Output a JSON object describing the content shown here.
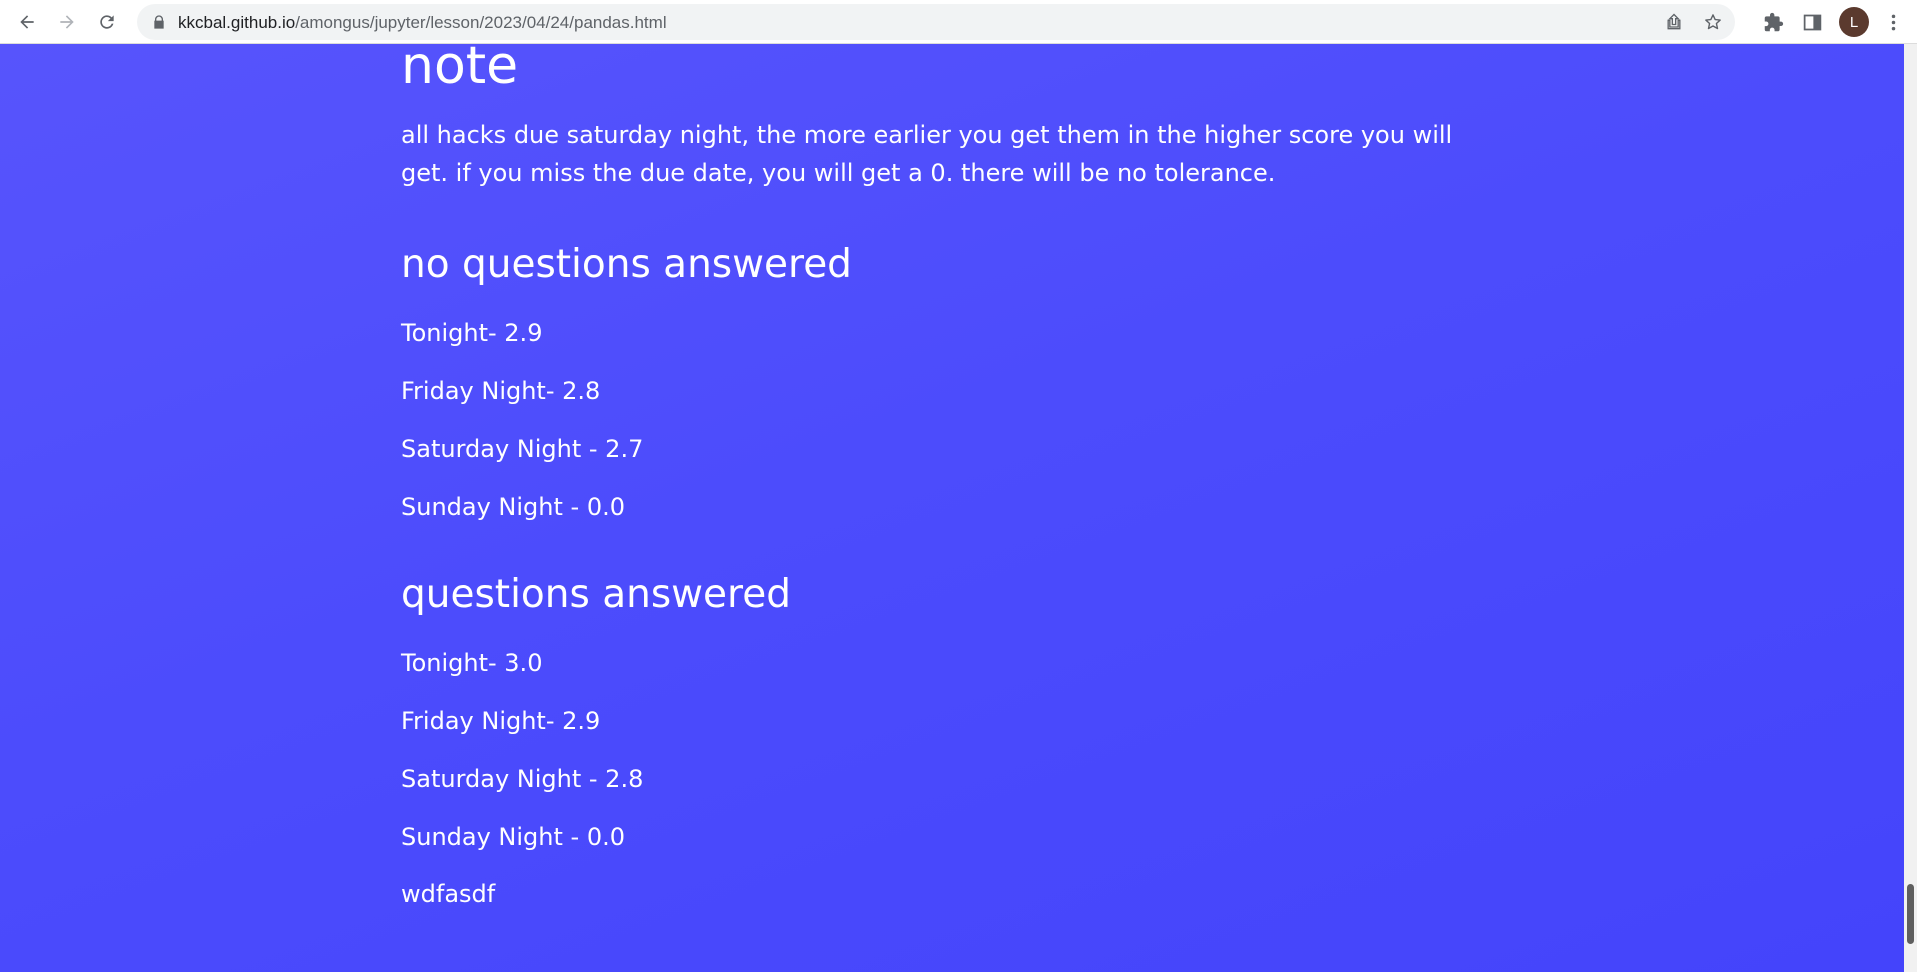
{
  "browser": {
    "url_host": "kkcbal.github.io",
    "url_path": "/amongus/jupyter/lesson/2023/04/24/pandas.html",
    "avatar_letter": "L",
    "accent_color": "#5b3a2e"
  },
  "icons": [
    "back-arrow-icon",
    "forward-arrow-icon",
    "reload-icon",
    "lock-icon",
    "share-icon",
    "star-icon",
    "puzzle-icon",
    "side-panel-icon",
    "kebab-menu-icon"
  ],
  "page": {
    "background_color": "#4c4cfc",
    "note_heading": "note",
    "note_text": "all hacks due saturday night, the more earlier you get them in the higher score you will get. if you miss the due date, you will get a 0. there will be no tolerance.",
    "section_no_questions": {
      "heading": "no questions answered",
      "lines": [
        "Tonight- 2.9",
        "Friday Night- 2.8",
        "Saturday Night - 2.7",
        "Sunday Night - 0.0"
      ]
    },
    "section_questions": {
      "heading": "questions answered",
      "lines": [
        "Tonight- 3.0",
        "Friday Night- 2.9",
        "Saturday Night - 2.8",
        "Sunday Night - 0.0"
      ]
    },
    "trailing_text": "wdfasdf"
  }
}
